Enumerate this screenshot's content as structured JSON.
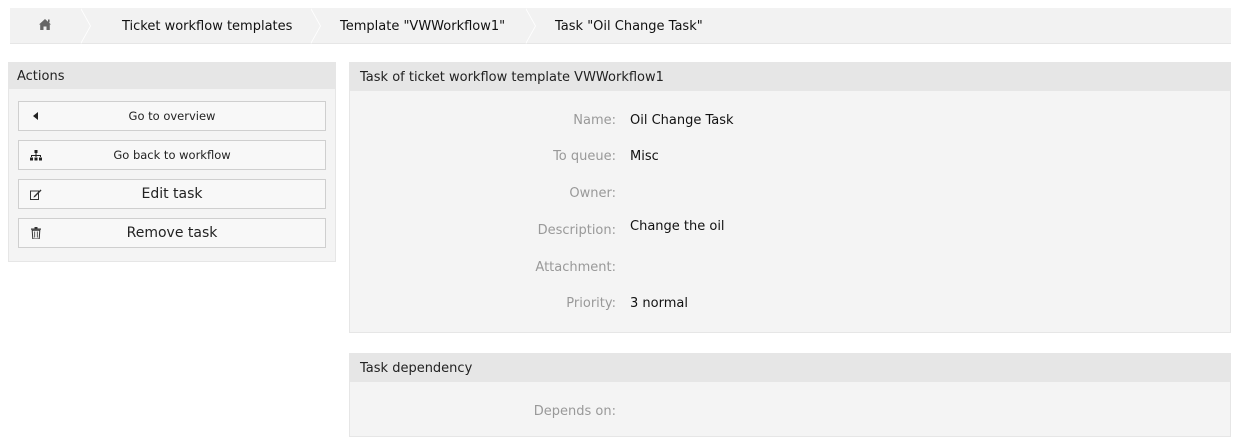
{
  "breadcrumb": {
    "home_icon": "home-icon",
    "items": [
      {
        "label": "Ticket workflow templates"
      },
      {
        "label": "Template \"VWWorkflow1\""
      },
      {
        "label": "Task \"Oil Change Task\""
      }
    ]
  },
  "sidebar": {
    "title": "Actions",
    "buttons": [
      {
        "label": "Go to overview",
        "icon": "caret-left-icon"
      },
      {
        "label": "Go back to workflow",
        "icon": "sitemap-icon"
      },
      {
        "label": "Edit task",
        "icon": "edit-icon"
      },
      {
        "label": "Remove task",
        "icon": "trash-icon"
      }
    ]
  },
  "task_widget": {
    "title": "Task of ticket workflow template VWWorkflow1",
    "fields": [
      {
        "label": "Name:",
        "value": "Oil Change Task"
      },
      {
        "label": "To queue:",
        "value": "Misc"
      },
      {
        "label": "Owner:",
        "value": ""
      },
      {
        "label": "Description:",
        "value": "Change the oil"
      },
      {
        "label": "Attachment:",
        "value": ""
      },
      {
        "label": "Priority:",
        "value": "3 normal"
      }
    ]
  },
  "dependency_widget": {
    "title": "Task dependency",
    "fields": [
      {
        "label": "Depends on:",
        "value": ""
      }
    ]
  }
}
